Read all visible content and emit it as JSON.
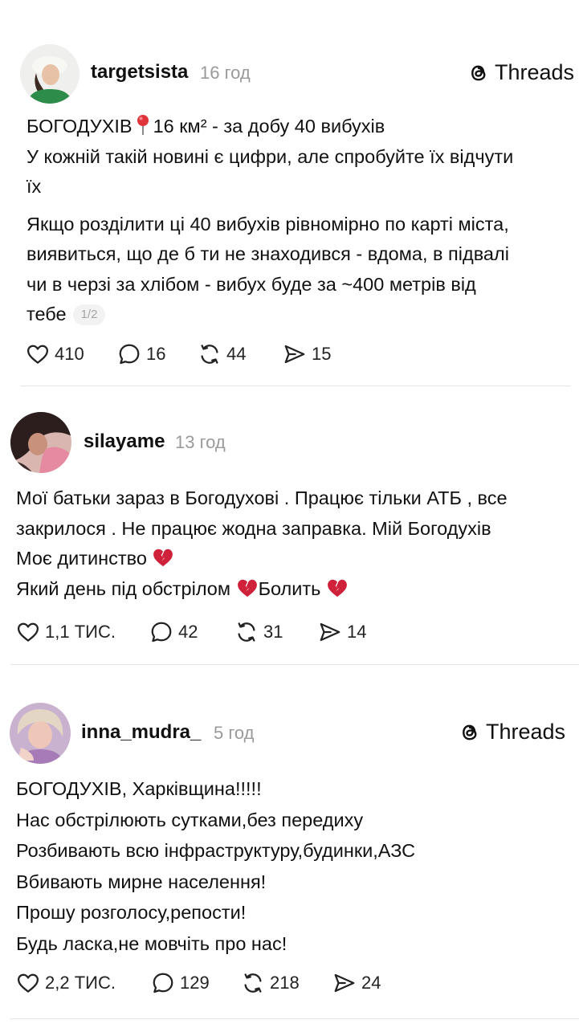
{
  "colors": {
    "text": "#111111",
    "muted": "#9a9a9a",
    "divider": "#e6e6e6",
    "heart": "#d0213a"
  },
  "posts": [
    {
      "username": "targetsista",
      "time": "16 год",
      "brand": "Threads",
      "lines": [
        "БОГОДУХІВ",
        "16 км² - за добу 40 вибухів",
        "У кожній такій новині є цифри, але спробуйте їх відчути",
        "їх",
        "Якщо розділити ці 40 вибухів рівномірно по карті міста,",
        "виявиться, що де б ти не знаходився - вдома, в підвалі",
        "чи в черзі за хлібом - вибух буде за ~400 метрів від",
        "тебе"
      ],
      "pager": "1/2",
      "stats": {
        "likes": "410",
        "replies": "16",
        "reposts": "44",
        "shares": "15"
      }
    },
    {
      "username": "silayame",
      "time": "13 год",
      "lines": [
        "Мої батьки зараз в Богодухові . Працює тільки АТБ , все",
        "закрилося . Не працює жодна заправка.  Мій Богодухів",
        "Моє дитинство",
        "Який день під обстрілом",
        "Болить"
      ],
      "stats": {
        "likes": "1,1 ТИС.",
        "replies": "42",
        "reposts": "31",
        "shares": "14"
      }
    },
    {
      "username": "inna_mudra_",
      "time": "5 год",
      "brand": "Threads",
      "lines": [
        "БОГОДУХІВ, Харківщина!!!!!",
        "Нас обстрілюють сутками,без передиху",
        "Розбивають всю інфраструктуру,будинки,АЗС",
        "Вбивають мирне населення!",
        "Прошу розголосу,репости!",
        "Будь ласка,не мовчіть про нас!"
      ],
      "stats": {
        "likes": "2,2 ТИС.",
        "replies": "129",
        "reposts": "218",
        "shares": "24"
      }
    }
  ]
}
